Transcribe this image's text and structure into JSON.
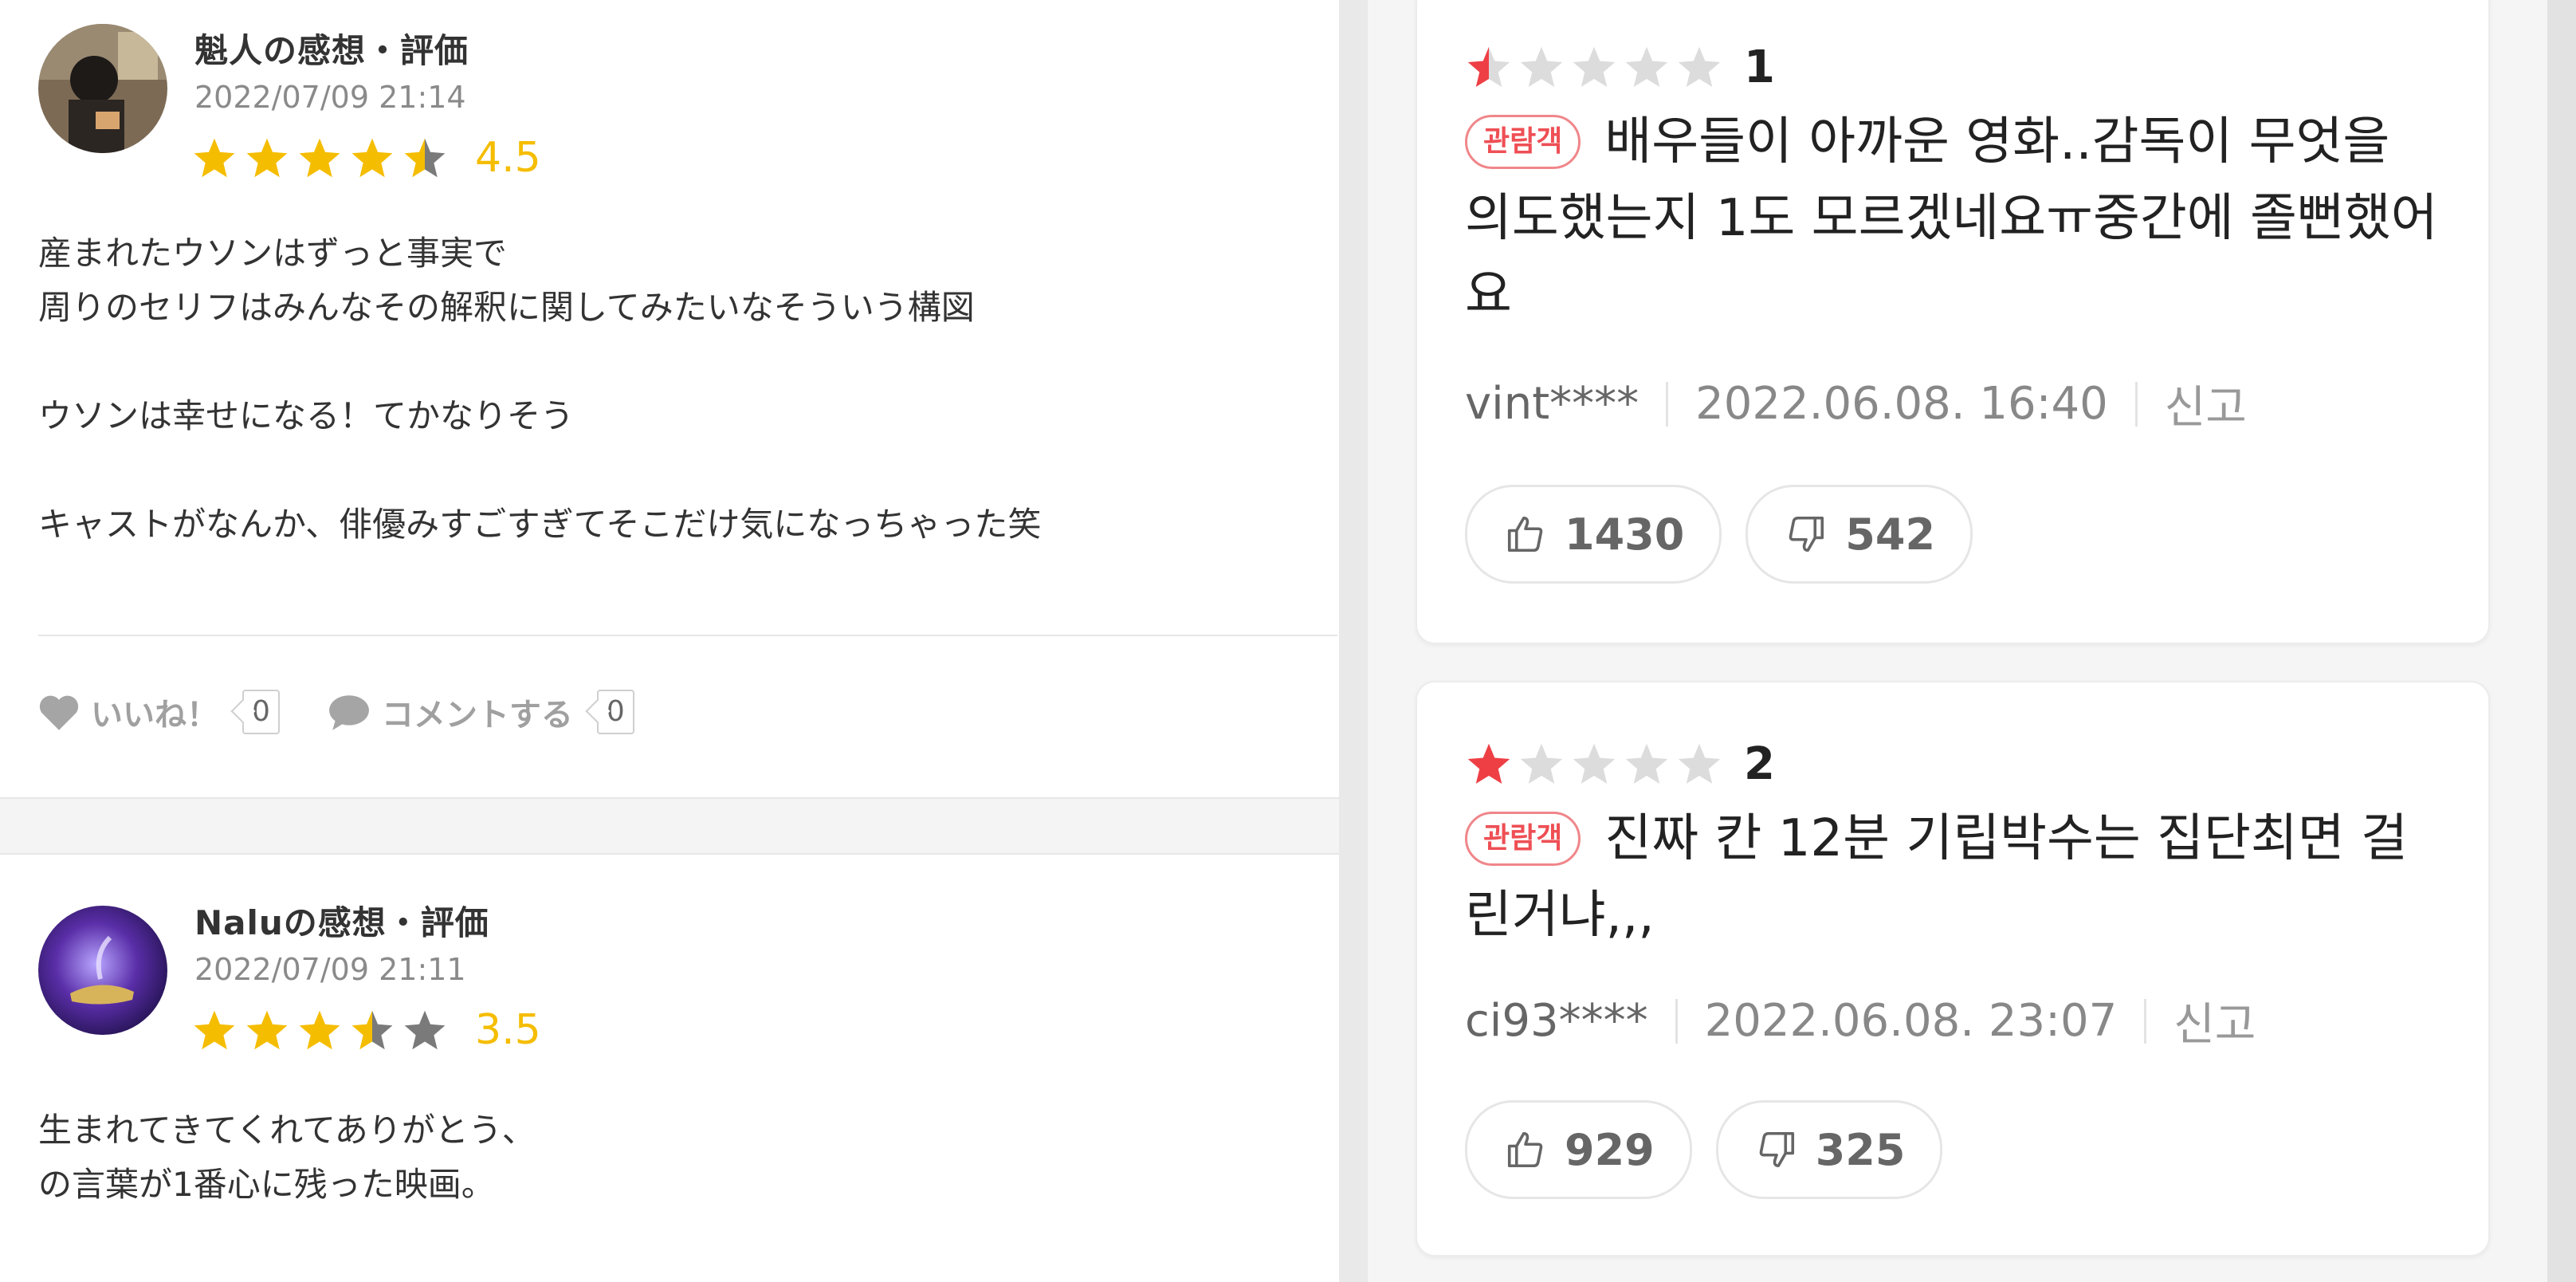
{
  "left_reviews": [
    {
      "author": "魁人の感想・評価",
      "date": "2022/07/09 21:14",
      "rating": 4.5,
      "score_text": "4.5",
      "lines": [
        "産まれたウソンはずっと事実で",
        "周りのセリフはみんなその解釈に関してみたいなそういう構図",
        "",
        "ウソンは幸せになる！てかなりそう",
        "",
        "キャストがなんか、俳優みすごすぎてそこだけ気になっちゃった笑"
      ],
      "like_label": "いいね！",
      "like_count": "0",
      "comment_label": "コメントする",
      "comment_count": "0"
    },
    {
      "author": "Naluの感想・評価",
      "date": "2022/07/09 21:11",
      "rating": 3.5,
      "score_text": "3.5",
      "lines": [
        "生まれてきてくれてありがとう、",
        "の言葉が1番心に残った映画。"
      ]
    }
  ],
  "right_reviews": [
    {
      "score": "1",
      "rating_fraction": 0.1,
      "badge": "관람객",
      "lines": [
        "배우들이 아까운 영화..감독이 무엇을",
        "의도했는지 1도 모르겠네요ㅠ중간에 졸뻔했어",
        "요"
      ],
      "user": "vint****",
      "date": "2022.06.08. 16:40",
      "report": "신고",
      "likes": "1430",
      "dislikes": "542"
    },
    {
      "score": "2",
      "rating_fraction": 0.2,
      "badge": "관람객",
      "lines": [
        "진짜 칸 12분 기립박수는 집단최면 걸",
        "린거냐,,,"
      ],
      "user": "ci93****",
      "date": "2022.06.08. 23:07",
      "report": "신고",
      "likes": "929",
      "dislikes": "325"
    }
  ],
  "colors": {
    "star_gold": "#f5bd00",
    "star_grey_jp": "#7a7a7a",
    "star_red": "#ee3f45",
    "star_grey_kr": "#dcdcdc",
    "badge_red": "#ee4f55"
  },
  "icons": {
    "like": "heart-icon",
    "comment": "speech-bubble-icon",
    "thumbs_up": "thumbs-up-icon",
    "thumbs_down": "thumbs-down-icon",
    "star": "star-icon"
  }
}
